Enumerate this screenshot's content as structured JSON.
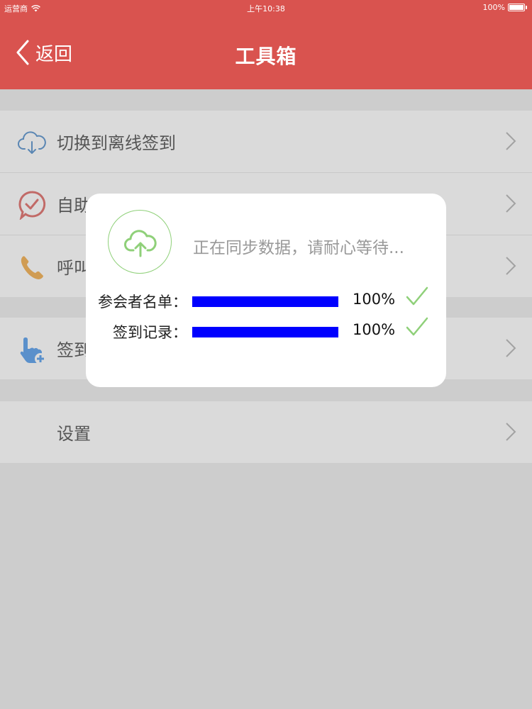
{
  "status_bar": {
    "carrier": "运营商",
    "time": "上午10:38",
    "battery": "100%"
  },
  "nav": {
    "back_label": "返回",
    "title": "工具箱"
  },
  "list": {
    "group1": [
      {
        "label": "切换到离线签到",
        "icon": "cloud-download-icon"
      },
      {
        "label": "自助",
        "icon": "checkmark-bubble-icon"
      },
      {
        "label": "呼叫",
        "icon": "phone-icon"
      }
    ],
    "group2": [
      {
        "label": "签到",
        "icon": "hand-pointer-plus-icon"
      }
    ],
    "group3": [
      {
        "label": "设置",
        "icon": ""
      }
    ]
  },
  "dialog": {
    "icon": "cloud-upload-icon",
    "message": "正在同步数据，请耐心等待...",
    "rows": [
      {
        "label": "参会者名单：",
        "progress": 1.0,
        "percent": "100%"
      },
      {
        "label": "签到记录：",
        "progress": 1.0,
        "percent": "100%"
      }
    ]
  },
  "colors": {
    "nav_bg": "#d9534f",
    "progress_fill": "#0000ff",
    "check": "#8fd079"
  }
}
